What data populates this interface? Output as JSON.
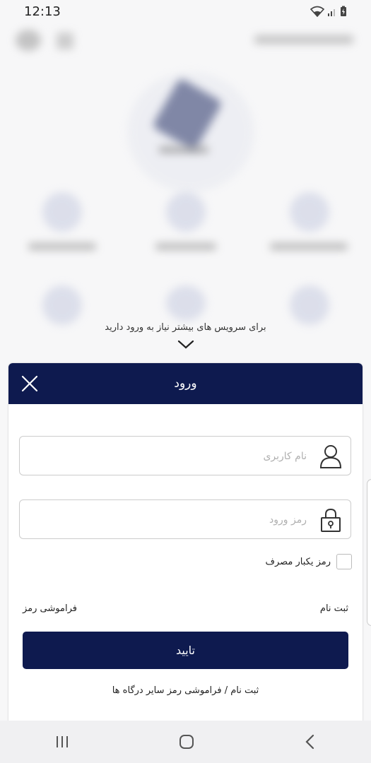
{
  "status_bar": {
    "time": "12:13"
  },
  "login_hint": "برای سرویس های بیشتر نیاز به ورود دارید",
  "sheet": {
    "title": "ورود",
    "username_placeholder": "نام کاربری",
    "password_placeholder": "رمز ورود",
    "otp_label": "رمز یکبار مصرف",
    "forgot_password": "فراموشی رمز",
    "register": "ثبت نام",
    "confirm_label": "تایید",
    "other_portals_link": "ثبت نام / فراموشی رمز سایر درگاه ها"
  },
  "colors": {
    "primary": "#0e1a4f",
    "background": "#f7f7f8"
  }
}
